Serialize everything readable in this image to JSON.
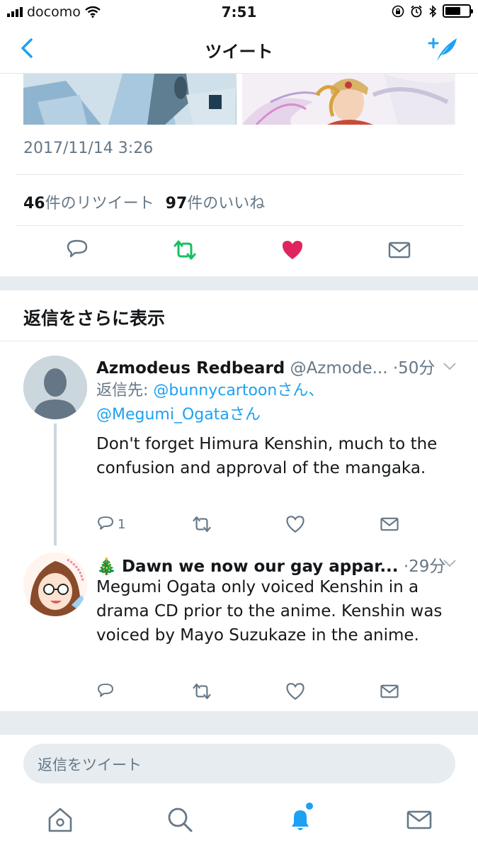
{
  "status_bar": {
    "carrier": "docomo",
    "time": "7:51"
  },
  "nav": {
    "title": "ツイート"
  },
  "tweet": {
    "timestamp": "2017/11/14 3:26",
    "retweet_count": "46",
    "retweet_label": "件のリツイート",
    "like_count": "97",
    "like_label": "件のいいね"
  },
  "more_replies": "返信をさらに表示",
  "replies": [
    {
      "name": "Azmodeus Redbeard",
      "handle": "@Azmode...",
      "time": "·50分",
      "reply_to_prefix": "返信先: ",
      "reply_to_1": "@bunnycartoonさん、",
      "reply_to_2": "@Megumi_Ogataさん",
      "text": "Don't forget Himura Kenshin, much to the confusion and approval of the mangaka.",
      "reply_count": "1"
    },
    {
      "emoji": "🎄",
      "name": "Dawn we now our gay appar...",
      "time": "·29分",
      "text": "Megumi Ogata only voiced Kenshin in a drama CD prior to the anime. Kenshin was voiced by Mayo Suzukaze in the anime.",
      "reply_count": ""
    }
  ],
  "reply_box": {
    "placeholder": "返信をツイート"
  },
  "colors": {
    "accent": "#1da1f2",
    "retweet": "#17bf63",
    "like": "#e0245e",
    "muted": "#657786"
  },
  "icons": [
    "back-arrow-icon",
    "compose-tweet-icon",
    "reply-icon",
    "retweet-icon",
    "like-icon",
    "direct-message-icon",
    "home-icon",
    "search-icon",
    "notifications-icon",
    "messages-icon"
  ]
}
